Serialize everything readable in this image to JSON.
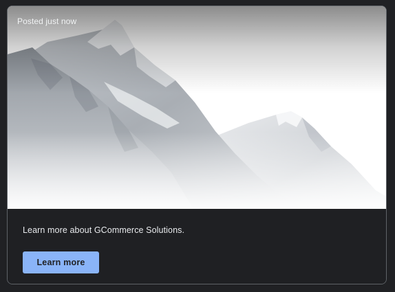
{
  "card": {
    "caption": "Posted just now",
    "image_subject": "snow-capped mountains",
    "description": "Learn more about GCommerce Solutions.",
    "button_label": "Learn more"
  },
  "colors": {
    "page_background": "#202124",
    "card_border": "#5f6368",
    "card_background": "#1f2023",
    "button_background": "#8ab4f8",
    "button_text": "#202124",
    "text_primary": "#e8eaed"
  }
}
